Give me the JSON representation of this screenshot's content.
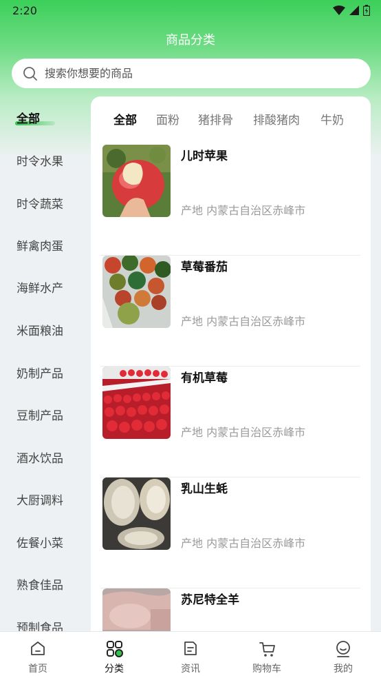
{
  "status_bar": {
    "time": "2:20"
  },
  "header": {
    "title": "商品分类"
  },
  "search": {
    "placeholder": "搜索你想要的商品"
  },
  "sidebar": {
    "items": [
      {
        "label": "全部",
        "active": true
      },
      {
        "label": "时令水果"
      },
      {
        "label": "时令蔬菜"
      },
      {
        "label": "鲜禽肉蛋"
      },
      {
        "label": "海鲜水产"
      },
      {
        "label": "米面粮油"
      },
      {
        "label": "奶制产品"
      },
      {
        "label": "豆制产品"
      },
      {
        "label": "酒水饮品"
      },
      {
        "label": "大厨调料"
      },
      {
        "label": "佐餐小菜"
      },
      {
        "label": "熟食佳品"
      },
      {
        "label": "预制食品"
      }
    ]
  },
  "subtabs": [
    {
      "label": "全部",
      "active": true
    },
    {
      "label": "面粉"
    },
    {
      "label": "猪排骨"
    },
    {
      "label": "排酸猪肉"
    },
    {
      "label": "牛奶"
    }
  ],
  "products": [
    {
      "name": "儿时苹果",
      "origin": "产地 内蒙古自治区赤峰市",
      "image": "apple-photo"
    },
    {
      "name": "草莓番茄",
      "origin": "产地 内蒙古自治区赤峰市",
      "image": "tomato-photo"
    },
    {
      "name": "有机草莓",
      "origin": "产地 内蒙古自治区赤峰市",
      "image": "strawberry-photo"
    },
    {
      "name": "乳山生蚝",
      "origin": "产地 内蒙古自治区赤峰市",
      "image": "oyster-photo"
    },
    {
      "name": "苏尼特全羊",
      "origin": "",
      "image": "lamb-photo"
    }
  ],
  "tabbar": {
    "items": [
      {
        "label": "首页",
        "icon": "home-icon"
      },
      {
        "label": "分类",
        "icon": "category-icon",
        "active": true
      },
      {
        "label": "资讯",
        "icon": "news-icon"
      },
      {
        "label": "购物车",
        "icon": "cart-icon"
      },
      {
        "label": "我的",
        "icon": "profile-icon"
      }
    ]
  },
  "colors": {
    "accent": "#35c24e",
    "header_green": "#3ccf5a",
    "muted_text": "#9a9a9a"
  }
}
